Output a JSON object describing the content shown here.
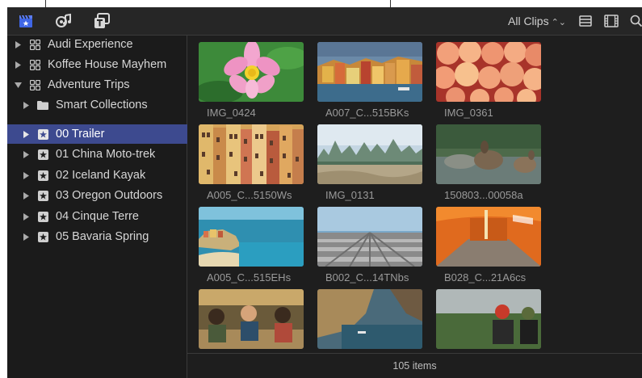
{
  "toolbar": {
    "icons": [
      "libraries-clapper-icon",
      "photos-audio-icon",
      "titles-generators-icon"
    ],
    "filter_label": "All Clips",
    "filter_chevron": "⌃⌄",
    "right_icons": [
      "list-view-icon",
      "filmstrip-view-icon",
      "search-icon"
    ]
  },
  "sidebar": {
    "items": [
      {
        "label": "Audi Experience",
        "icon": "library-icon",
        "expanded": false,
        "selected": false
      },
      {
        "label": "Koffee House Mayhem",
        "icon": "library-icon",
        "expanded": false,
        "selected": false
      },
      {
        "label": "Adventure Trips",
        "icon": "library-icon",
        "expanded": true,
        "selected": false
      },
      {
        "label": "Smart Collections",
        "icon": "folder-icon",
        "expanded": false,
        "selected": false
      },
      {
        "label": "00 Trailer",
        "icon": "event-icon",
        "expanded": false,
        "selected": true
      },
      {
        "label": "01 China Moto-trek",
        "icon": "event-icon",
        "expanded": false,
        "selected": false
      },
      {
        "label": "02 Iceland Kayak",
        "icon": "event-icon",
        "expanded": false,
        "selected": false
      },
      {
        "label": "03 Oregon Outdoors",
        "icon": "event-icon",
        "expanded": false,
        "selected": false
      },
      {
        "label": "04 Cinque Terre",
        "icon": "event-icon",
        "expanded": false,
        "selected": false
      },
      {
        "label": "05 Bavaria Spring",
        "icon": "event-icon",
        "expanded": false,
        "selected": false
      }
    ]
  },
  "clips": [
    {
      "label": "IMG_0424"
    },
    {
      "label": "A007_C...515BKs"
    },
    {
      "label": "IMG_0361"
    },
    {
      "label": "A005_C...5150Ws"
    },
    {
      "label": "IMG_0131"
    },
    {
      "label": "150803...00058a"
    },
    {
      "label": "A005_C...515EHs"
    },
    {
      "label": "B002_C...14TNbs"
    },
    {
      "label": "B028_C...21A6cs"
    },
    {
      "label": ""
    },
    {
      "label": ""
    },
    {
      "label": ""
    }
  ],
  "footer": {
    "count_label": "105 items"
  },
  "colors": {
    "selection": "#3d4a8f",
    "accent_icon": "#5b7cf0"
  }
}
